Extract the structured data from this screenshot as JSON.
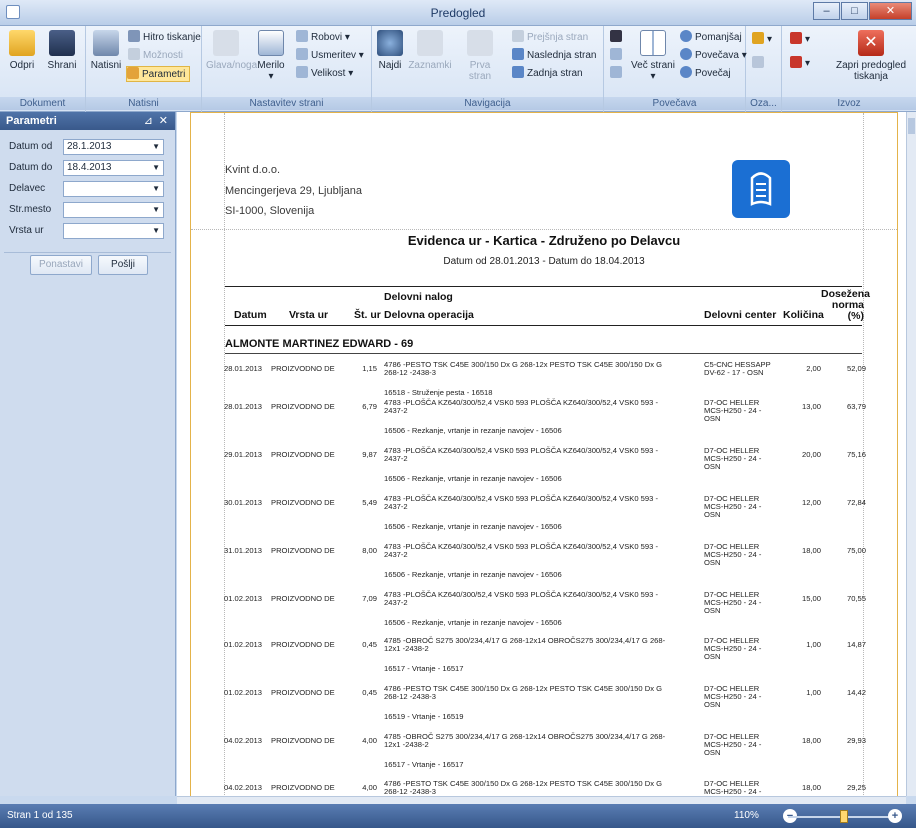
{
  "window": {
    "title": "Predogled"
  },
  "ribbon": {
    "groups": {
      "dokument": {
        "label": "Dokument",
        "odpri": "Odpri",
        "shrani": "Shrani"
      },
      "natisni": {
        "label": "Natisni",
        "natisni": "Natisni",
        "hitro": "Hitro tiskanje",
        "moznosti": "Možnosti",
        "parametri": "Parametri"
      },
      "nastavitev": {
        "label": "Nastavitev strani",
        "glava": "Glava/noga",
        "merilo": "Merilo",
        "robovi": "Robovi",
        "usmeritev": "Usmeritev",
        "velikost": "Velikost"
      },
      "navigacija": {
        "label": "Navigacija",
        "najdi": "Najdi",
        "zaznamki": "Zaznamki",
        "prva": "Prva stran",
        "prejsnja": "Prejšnja stran",
        "naslednja": "Naslednja stran",
        "zadnja": "Zadnja stran"
      },
      "povecava": {
        "label": "Povečava",
        "vec": "Več strani",
        "pomanjsaj": "Pomanjšaj",
        "povecava": "Povečava",
        "povecaj": "Povečaj"
      },
      "ozadje": {
        "label": "Oza..."
      },
      "izvoz": {
        "label": "Izvoz",
        "zapri": "Zapri predogled tiskanja"
      }
    }
  },
  "params": {
    "title": "Parametri",
    "fields": [
      {
        "label": "Datum od",
        "value": "28.1.2013"
      },
      {
        "label": "Datum do",
        "value": "18.4.2013"
      },
      {
        "label": "Delavec",
        "value": ""
      },
      {
        "label": "Str.mesto",
        "value": ""
      },
      {
        "label": "Vrsta ur",
        "value": ""
      }
    ],
    "reset": "Ponastavi",
    "send": "Pošlji"
  },
  "report": {
    "company": [
      "Kvint d.o.o.",
      "Mencingerjeva 29, Ljubljana",
      "SI-1000, Slovenija"
    ],
    "title": "Evidenca ur - Kartica - Združeno po Delavcu",
    "subtitle": "Datum od 28.01.2013 - Datum do 18.04.2013",
    "headers": {
      "datum": "Datum",
      "vrsta": "Vrsta ur",
      "stur": "Št. ur",
      "nalog": "Delovni nalog",
      "operacija": "Delovna operacija",
      "center": "Delovni center",
      "kolicina": "Količina",
      "norma1": "Dosežena",
      "norma2": "norma",
      "norma3": "(%)"
    },
    "group": "ALMONTE MARTINEZ EDWARD - 69",
    "rows": [
      {
        "date": "28.01.2013",
        "type": "PROIZVODNO DE",
        "hours": "1,15",
        "order1": "4786 -PESTO TSK C45E 300/150 Dx G 268-12x PESTO TSK C45E 300/150 Dx G",
        "order2": "268-12 -2438-3",
        "op": "16518 - Struženje pesta - 16518",
        "center1": "C5-CNC HESSAPP",
        "center2": "DV-62 - 17 - OSN",
        "center3": "",
        "qty": "2,00",
        "norm": "52,09"
      },
      {
        "date": "28.01.2013",
        "type": "PROIZVODNO DE",
        "hours": "6,79",
        "order1": "4783 -PLOŠČA KZ640/300/52,4 VSK0 593 PLOŠČA KZ640/300/52,4 VSK0 593 -",
        "order2": "2437-2",
        "op": "16506 - Rezkanje, vrtanje in rezanje navojev - 16506",
        "center1": "D7-OC HELLER",
        "center2": "MCS-H250 - 24 -",
        "center3": "OSN",
        "qty": "13,00",
        "norm": "63,79"
      },
      {
        "date": "29.01.2013",
        "type": "PROIZVODNO DE",
        "hours": "9,87",
        "order1": "4783 -PLOŠČA KZ640/300/52,4 VSK0 593 PLOŠČA KZ640/300/52,4 VSK0 593 -",
        "order2": "2437-2",
        "op": "16506 - Rezkanje, vrtanje in rezanje navojev - 16506",
        "center1": "D7-OC HELLER",
        "center2": "MCS-H250 - 24 -",
        "center3": "OSN",
        "qty": "20,00",
        "norm": "75,16"
      },
      {
        "date": "30.01.2013",
        "type": "PROIZVODNO DE",
        "hours": "5,49",
        "order1": "4783 -PLOŠČA KZ640/300/52,4 VSK0 593 PLOŠČA KZ640/300/52,4 VSK0 593 -",
        "order2": "2437-2",
        "op": "16506 - Rezkanje, vrtanje in rezanje navojev - 16506",
        "center1": "D7-OC HELLER",
        "center2": "MCS-H250 - 24 -",
        "center3": "OSN",
        "qty": "12,00",
        "norm": "72,84"
      },
      {
        "date": "31.01.2013",
        "type": "PROIZVODNO DE",
        "hours": "8,00",
        "order1": "4783 -PLOŠČA KZ640/300/52,4 VSK0 593 PLOŠČA KZ640/300/52,4 VSK0 593 -",
        "order2": "2437-2",
        "op": "16506 - Rezkanje, vrtanje in rezanje navojev - 16506",
        "center1": "D7-OC HELLER",
        "center2": "MCS-H250 - 24 -",
        "center3": "OSN",
        "qty": "18,00",
        "norm": "75,00"
      },
      {
        "date": "01.02.2013",
        "type": "PROIZVODNO DE",
        "hours": "7,09",
        "order1": "4783 -PLOŠČA KZ640/300/52,4 VSK0 593 PLOŠČA KZ640/300/52,4 VSK0 593 -",
        "order2": "2437-2",
        "op": "16506 - Rezkanje, vrtanje in rezanje navojev - 16506",
        "center1": "D7-OC HELLER",
        "center2": "MCS-H250 - 24 -",
        "center3": "OSN",
        "qty": "15,00",
        "norm": "70,55"
      },
      {
        "date": "01.02.2013",
        "type": "PROIZVODNO DE",
        "hours": "0,45",
        "order1": "4785 -OBROČ S275 300/234,4/17 G 268-12x14 OBROČS275 300/234,4/17 G 268-",
        "order2": "12x1 -2438-2",
        "op": "16517 - Vrtanje - 16517",
        "center1": "D7-OC HELLER",
        "center2": "MCS-H250 - 24 -",
        "center3": "OSN",
        "qty": "1,00",
        "norm": "14,87"
      },
      {
        "date": "01.02.2013",
        "type": "PROIZVODNO DE",
        "hours": "0,45",
        "order1": "4786 -PESTO TSK C45E 300/150 Dx G 268-12x PESTO TSK C45E 300/150 Dx G",
        "order2": "268-12 -2438-3",
        "op": "16519 - Vrtanje - 16519",
        "center1": "D7-OC HELLER",
        "center2": "MCS-H250 - 24 -",
        "center3": "OSN",
        "qty": "1,00",
        "norm": "14,42"
      },
      {
        "date": "04.02.2013",
        "type": "PROIZVODNO DE",
        "hours": "4,00",
        "order1": "4785 -OBROČ S275 300/234,4/17 G 268-12x14 OBROČS275 300/234,4/17 G 268-",
        "order2": "12x1 -2438-2",
        "op": "16517 - Vrtanje - 16517",
        "center1": "D7-OC HELLER",
        "center2": "MCS-H250 - 24 -",
        "center3": "OSN",
        "qty": "18,00",
        "norm": "29,93"
      },
      {
        "date": "04.02.2013",
        "type": "PROIZVODNO DE",
        "hours": "4,00",
        "order1": "4786 -PESTO TSK C45E 300/150 Dx G 268-12x PESTO TSK C45E 300/150 Dx G",
        "order2": "268-12 -2438-3",
        "op": "",
        "center1": "D7-OC HELLER",
        "center2": "MCS-H250 - 24 -",
        "center3": "",
        "qty": "18,00",
        "norm": "29,25"
      }
    ]
  },
  "status": {
    "page": "Stran 1 od 135",
    "zoom": "110%"
  },
  "colors": {
    "accent": "#39598b",
    "page_border": "#e4b34a",
    "logo": "#1b6fd3"
  }
}
